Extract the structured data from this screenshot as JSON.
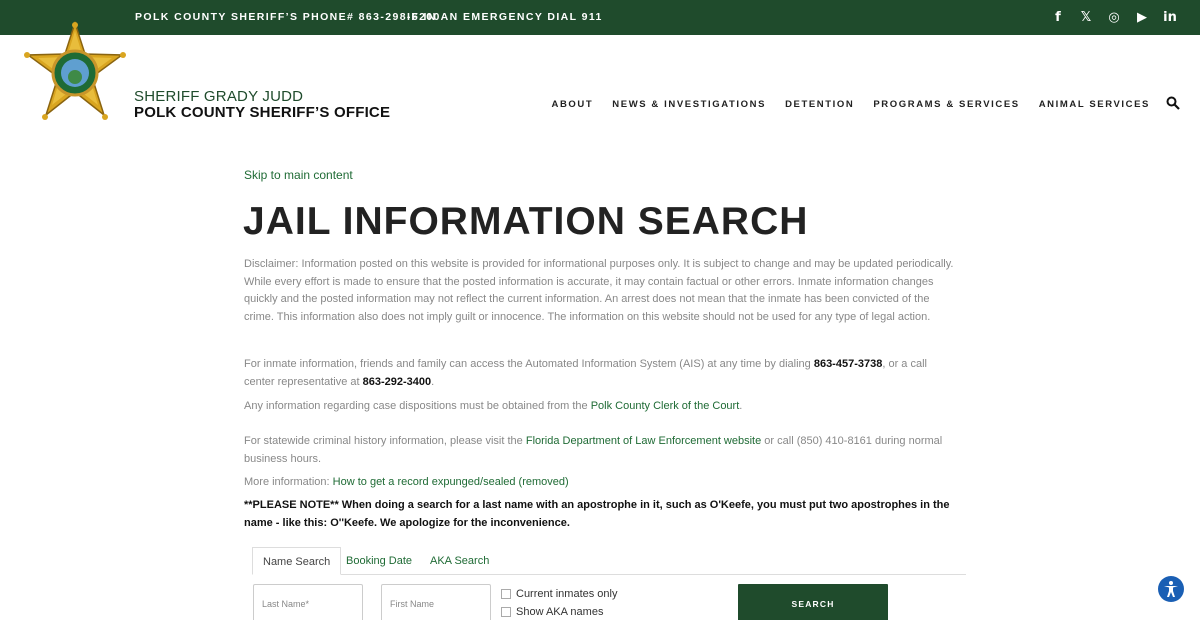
{
  "topbar": {
    "phone": "POLK COUNTY SHERIFF’S PHONE# 863-298-6200",
    "emergency": "IF IN AN EMERGENCY DIAL 911",
    "social": [
      "f",
      "𝕏",
      "◎",
      "▶",
      "in"
    ]
  },
  "header": {
    "brand_line1": "SHERIFF GRADY JUDD",
    "brand_line2": "POLK COUNTY SHERIFF’S OFFICE",
    "nav": [
      "ABOUT",
      "NEWS & INVESTIGATIONS",
      "DETENTION",
      "PROGRAMS & SERVICES",
      "ANIMAL SERVICES"
    ]
  },
  "content": {
    "skip": "Skip to main content",
    "title": "JAIL INFORMATION SEARCH",
    "disclaimer": "Disclaimer: Information posted on this website is provided for informational purposes only. It is subject to change and may be updated periodically. While every effort is made to ensure that the posted information is accurate, it may contain factual or other errors. Inmate information changes quickly and the posted information may not reflect the current information. An arrest does not mean that the inmate has been convicted of the crime. This information also does not imply guilt or innocence.  The information on this website should not be used for any type of legal action.",
    "ais_pre": "For inmate information, friends and family can access the Automated Information System (AIS) at any time by dialing ",
    "ais_phone": "863-457-3738",
    "ais_mid": ", or a call center representative at ",
    "ais_phone2": "863-292-3400",
    "ais_post": ".",
    "clerk_pre": "Any information regarding case dispositions must be obtained from the ",
    "clerk_link": "Polk County Clerk of the Court",
    "clerk_post": ".",
    "fdle_pre": "For statewide criminal history information, please visit the ",
    "fdle_link": "Florida Department of Law Enforcement website",
    "fdle_post": " or call (850) 410-8161 during normal business hours.",
    "more_pre": "More information: ",
    "more_link": "How to get a record expunged/sealed (removed)",
    "note": "**PLEASE NOTE** When doing a search for a last name with an apostrophe in it, such as O'Keefe, you must put two apostrophes in the name - like this: O''Keefe. We apologize for the inconvenience."
  },
  "tabs": [
    "Name Search",
    "Booking Date",
    "AKA Search"
  ],
  "form": {
    "last_name_placeholder": "Last Name*",
    "first_name_placeholder": "First Name",
    "current_inmates": "Current inmates only",
    "show_aka": "Show AKA names",
    "search_button": "SEARCH"
  },
  "colors": {
    "brand_green": "#1f4b2c",
    "link_green": "#1f6b35",
    "accessibility_blue": "#1a5fb4"
  }
}
